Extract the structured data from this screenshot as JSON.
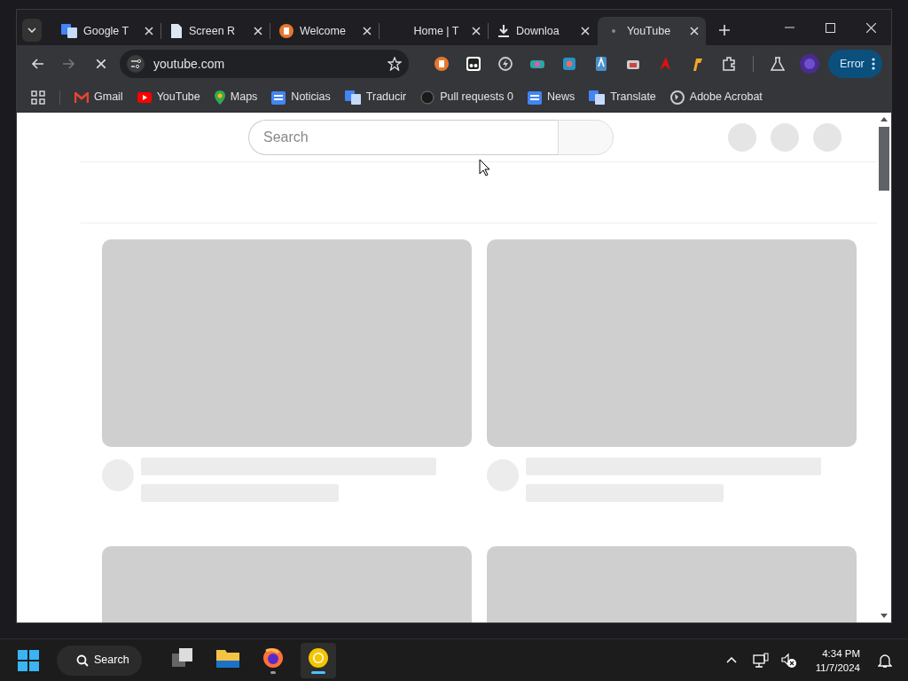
{
  "tabs": [
    {
      "kind": "translate",
      "title": "Google T",
      "selected": false
    },
    {
      "kind": "document",
      "title": "Screen R",
      "selected": false
    },
    {
      "kind": "badge",
      "title": "Welcome",
      "selected": false
    },
    {
      "kind": "none",
      "title": "Home | T",
      "selected": false
    },
    {
      "kind": "download",
      "title": "Downloa",
      "selected": false
    },
    {
      "kind": "loading",
      "title": "YouTube",
      "selected": true
    }
  ],
  "toolbar": {
    "address": "youtube.com",
    "loading": true,
    "forward_disabled": true,
    "profile_button": "Error"
  },
  "bookmarks": [
    {
      "kind": "gmail",
      "label": "Gmail"
    },
    {
      "kind": "youtube",
      "label": "YouTube"
    },
    {
      "kind": "maps",
      "label": "Maps"
    },
    {
      "kind": "news",
      "label": "Noticias"
    },
    {
      "kind": "translate",
      "label": "Traducir"
    },
    {
      "kind": "github",
      "label": "Pull requests 0"
    },
    {
      "kind": "news",
      "label": "News"
    },
    {
      "kind": "translate",
      "label": "Translate"
    },
    {
      "kind": "globe",
      "label": "Adobe Acrobat"
    }
  ],
  "page": {
    "search": {
      "placeholder": "Search"
    }
  },
  "taskbar": {
    "search": "Search",
    "apps": [
      {
        "kind": "taskview",
        "running": false,
        "selected": false
      },
      {
        "kind": "files",
        "running": false,
        "selected": false
      },
      {
        "kind": "firefox",
        "running": true,
        "selected": false
      },
      {
        "kind": "chrome",
        "running": true,
        "selected": true
      }
    ],
    "time": "4:34 PM",
    "date": "11/7/2024"
  }
}
